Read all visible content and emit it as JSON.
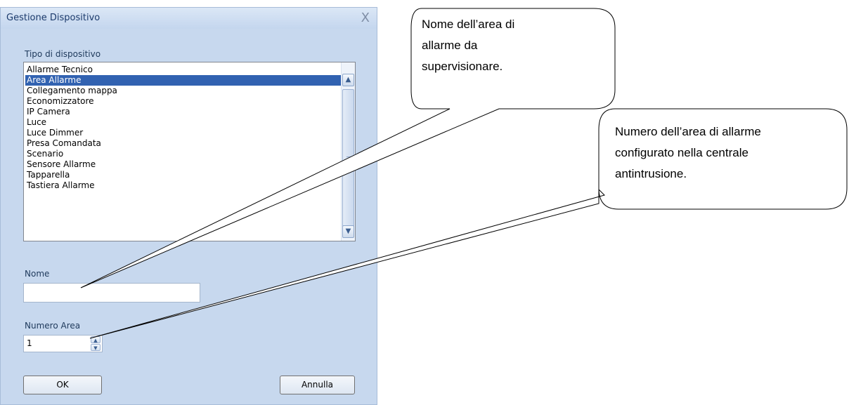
{
  "dialog": {
    "title": "Gestione Dispositivo",
    "close_glyph": "X",
    "device_type_label": "Tipo di dispositivo",
    "device_types": [
      "Allarme Tecnico",
      "Area Allarme",
      "Collegamento mappa",
      "Economizzatore",
      "IP Camera",
      "Luce",
      "Luce Dimmer",
      "Presa Comandata",
      "Scenario",
      "Sensore Allarme",
      "Tapparella",
      "Tastiera Allarme"
    ],
    "selected_device_type": "Area Allarme",
    "name_label": "Nome",
    "name_value": "",
    "area_number_label": "Numero Area",
    "area_number_value": "1",
    "ok_label": "OK",
    "cancel_label": "Annulla"
  },
  "callouts": {
    "area_name": [
      "Nome dell’area di",
      "allarme da",
      "supervisionare."
    ],
    "area_number": [
      "Numero dell’area di allarme",
      "configurato nella centrale",
      "antintrusione."
    ]
  },
  "icons": {
    "scroll_up": "chevron-up-icon",
    "scroll_down": "chevron-down-icon",
    "spin_up": "triangle-up-icon",
    "spin_down": "triangle-down-icon"
  }
}
